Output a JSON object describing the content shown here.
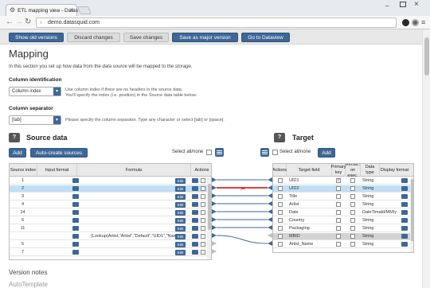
{
  "browser": {
    "tab_title": "ETL mapping view - Datas",
    "url": "demo.datasquid.com",
    "icons": [
      "gear-icon",
      "close-icon",
      "back-icon",
      "forward-icon",
      "reload-icon",
      "page-icon",
      "menu-icon"
    ]
  },
  "actionbar": {
    "show_old_versions": "Show old versions",
    "discard_changes": "Discard changes",
    "save_changes": "Save changes",
    "save_major": "Save as major version",
    "goto_dataview": "Go to Dataview"
  },
  "page": {
    "title": "Mapping",
    "intro_pre": "In this section you set up how data from the ",
    "intro_em1": "data source",
    "intro_mid": " will be mapped to the ",
    "intro_em2": "storage",
    "intro_post": "."
  },
  "column_identification": {
    "label": "Column identification",
    "selected": "Column index",
    "hint_line1": "Use column index if there are no headers in the source data.",
    "hint_line2": "You'll specify the index (i.e. position) in the Source data table below."
  },
  "column_separator": {
    "label": "Column separator",
    "selected": "[tab]",
    "hint": "Please specify the column separator. Type any character or select [tab] or [space]."
  },
  "source": {
    "help": "?",
    "title": "Source data",
    "add": "Add",
    "auto_create": "Auto-create sources",
    "select_all": "Select all/none",
    "headers": [
      "Source index",
      "Input format",
      "Formula",
      "Actions"
    ],
    "edit_label": "Edit",
    "rows": [
      {
        "index": "1",
        "formula": "",
        "selected": false
      },
      {
        "index": "2",
        "formula": "",
        "selected": true
      },
      {
        "index": "3",
        "formula": "",
        "selected": false
      },
      {
        "index": "4",
        "formula": "",
        "selected": false
      },
      {
        "index": "14",
        "formula": "",
        "selected": false
      },
      {
        "index": "6",
        "formula": "",
        "selected": false
      },
      {
        "index": "11",
        "formula": "",
        "selected": false
      },
      {
        "index": "",
        "formula": "{Lookup(Artist,\"Artist\",\"Default\",\"UID1\",\"Name\",\"\",\"",
        "selected": false
      },
      {
        "index": "5",
        "formula": "",
        "selected": false
      },
      {
        "index": "7",
        "formula": "",
        "selected": false
      }
    ]
  },
  "target": {
    "help": "?",
    "title": "Target",
    "select_all": "Select all/none",
    "add": "Add",
    "headers": [
      "Actions",
      "Target field",
      "Primary key",
      "Recalc. on exec.",
      "Data type",
      "Display format"
    ],
    "rows": [
      {
        "field": "UID1",
        "primary": true,
        "type": "String",
        "format": "",
        "selected": false,
        "gray": false
      },
      {
        "field": "UID2",
        "primary": false,
        "type": "String",
        "format": "",
        "selected": true,
        "gray": false
      },
      {
        "field": "Title",
        "primary": false,
        "type": "String",
        "format": "",
        "selected": false,
        "gray": false
      },
      {
        "field": "Artist",
        "primary": false,
        "type": "String",
        "format": "",
        "selected": false,
        "gray": false
      },
      {
        "field": "Date",
        "primary": false,
        "type": "DateTime",
        "format": "dd/MM/y",
        "selected": false,
        "gray": false
      },
      {
        "field": "Country",
        "primary": false,
        "type": "String",
        "format": "",
        "selected": false,
        "gray": false
      },
      {
        "field": "Packaging",
        "primary": false,
        "type": "String",
        "format": "",
        "selected": false,
        "gray": false
      },
      {
        "field": "MBID",
        "primary": false,
        "type": "String",
        "format": "",
        "selected": false,
        "gray": true
      },
      {
        "field": "Artist_Name",
        "primary": false,
        "type": "String",
        "format": "",
        "selected": false,
        "gray": false
      }
    ]
  },
  "footer": {
    "version_notes": "Version notes",
    "auto_template": "AutoTemplate"
  },
  "colors": {
    "accent": "#3e6798",
    "selected_row": "#bfe0f5",
    "mapping_broken": "#d40000"
  }
}
